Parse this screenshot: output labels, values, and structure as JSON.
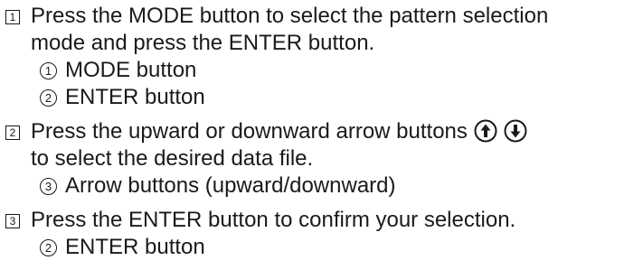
{
  "steps": [
    {
      "number": "1",
      "line1": "Press the MODE button to select the pattern selection",
      "line2": "mode and press the ENTER button.",
      "subitems": [
        {
          "marker": "1",
          "text": "MODE button"
        },
        {
          "marker": "2",
          "text": "ENTER button"
        }
      ]
    },
    {
      "number": "2",
      "line1": "Press the upward or downward arrow buttons",
      "icons": [
        "up-arrow-button-icon",
        "down-arrow-button-icon"
      ],
      "line2": "to select the desired data file.",
      "subitems": [
        {
          "marker": "3",
          "text": "Arrow buttons (upward/downward)"
        }
      ]
    },
    {
      "number": "3",
      "line1": "Press the ENTER button to confirm your selection.",
      "subitems": [
        {
          "marker": "2",
          "text": "ENTER button"
        }
      ]
    }
  ]
}
